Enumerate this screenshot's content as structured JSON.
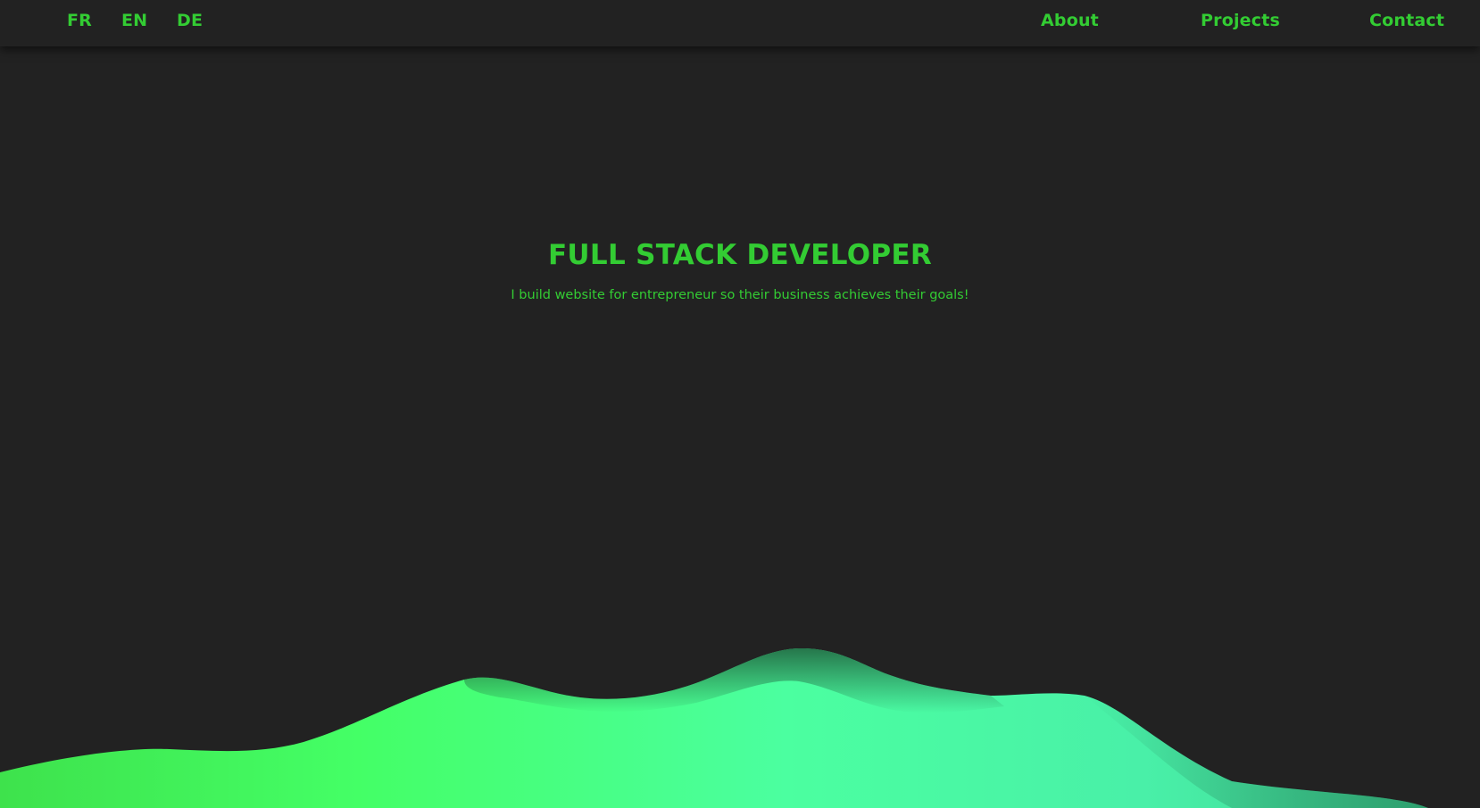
{
  "languages": {
    "fr": "FR",
    "en": "EN",
    "de": "DE"
  },
  "nav": {
    "about": "About",
    "projects": "Projects",
    "contact": "Contact"
  },
  "hero": {
    "title": "FULL STACK DEVELOPER",
    "subtitle": "I build website for entrepreneur so their business achieves their goals!"
  },
  "colors": {
    "background": "#222222",
    "accent": "#33cc33",
    "terrain_light": "#47ff6a",
    "terrain_mint": "#4bffb0",
    "terrain_dark": "#2e8f5a"
  }
}
